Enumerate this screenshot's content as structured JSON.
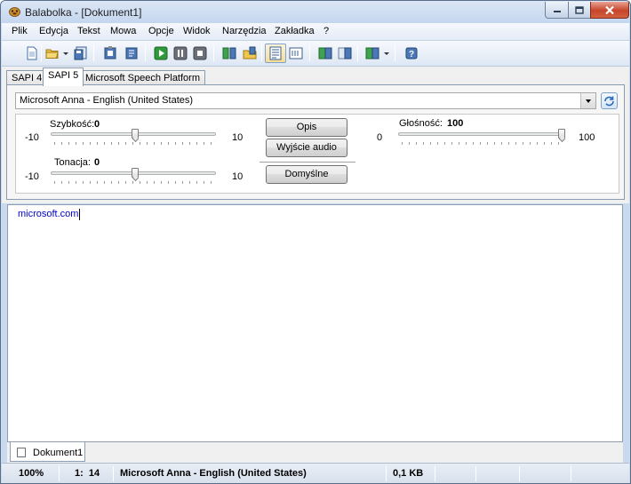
{
  "window": {
    "title": "Balabolka - [Dokument1]"
  },
  "menu": [
    "Plik",
    "Edycja",
    "Tekst",
    "Mowa",
    "Opcje",
    "Widok",
    "Narzędzia",
    "Zakładka",
    "?"
  ],
  "toolbar_icons": [
    "new-document-icon",
    "open-folder-icon",
    "save-icon",
    "read-clipboard-icon",
    "read-file-icon",
    "play-icon",
    "pause-icon",
    "stop-icon",
    "save-audio-icon",
    "split-file-icon",
    "text-view-icon",
    "bookmark-icon",
    "voice-1-icon",
    "voice-2-icon",
    "convert-icon",
    "help-icon"
  ],
  "voice_tabs": [
    "SAPI 4",
    "SAPI 5",
    "Microsoft Speech Platform"
  ],
  "voice": {
    "selected": "Microsoft Anna - English (United States)"
  },
  "params": {
    "rate": {
      "label": "Szybkość:",
      "value": "0",
      "min": "-10",
      "max": "10",
      "fraction": 0.5
    },
    "pitch": {
      "label": "Tonacja:",
      "value": "0",
      "min": "-10",
      "max": "10",
      "fraction": 0.5
    },
    "volume": {
      "label": "Głośność:",
      "value": "100",
      "min": "0",
      "max": "100",
      "fraction": 1.0
    }
  },
  "buttons": {
    "description": "Opis",
    "audio_output": "Wyjście audio",
    "defaults": "Domyślne"
  },
  "editor": {
    "text": "microsoft.com"
  },
  "doc_tab": {
    "label": "Dokument1"
  },
  "status": {
    "zoom": "100%",
    "position": "1:  14",
    "voice": "Microsoft Anna - English (United States)",
    "size": "0,1 KB"
  },
  "colors": {
    "link_text": "#0000cc",
    "close_button": "#c7442a"
  }
}
